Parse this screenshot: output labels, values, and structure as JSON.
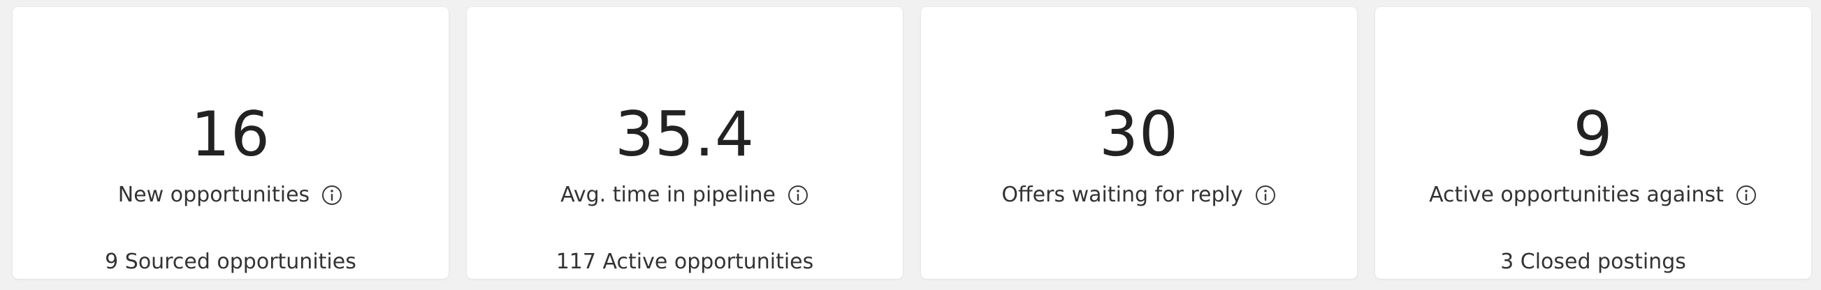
{
  "cards": [
    {
      "value": "16",
      "label": "New opportunities",
      "icon": "info-icon",
      "sub": "9 Sourced opportunities"
    },
    {
      "value": "35.4",
      "label": "Avg. time in pipeline",
      "icon": "info-icon",
      "sub": "117 Active opportunities"
    },
    {
      "value": "30",
      "label": "Offers waiting for reply",
      "icon": "info-icon",
      "sub": ""
    },
    {
      "value": "9",
      "label": "Active opportunities against",
      "icon": "info-icon",
      "sub": "3 Closed postings"
    }
  ]
}
